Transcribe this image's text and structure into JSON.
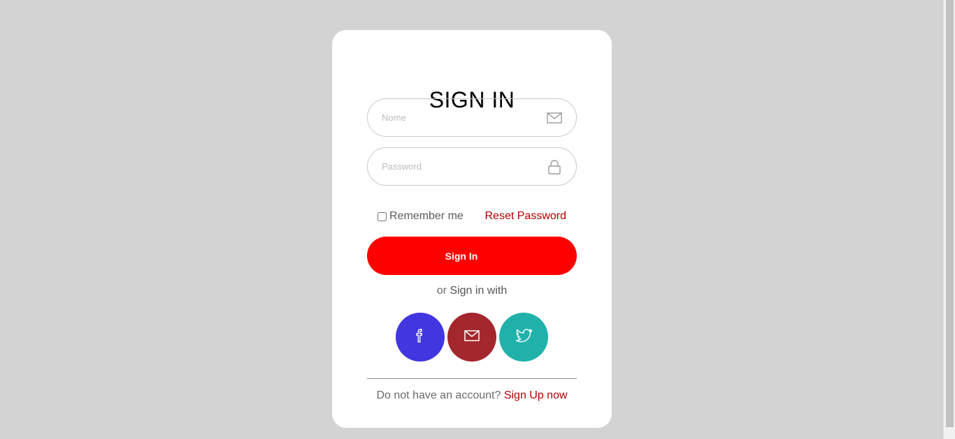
{
  "form": {
    "title": "SIGN IN",
    "name_placeholder": "Nome",
    "password_placeholder": "Password",
    "remember_label": "Remember me",
    "reset_label": "Reset Password",
    "submit_label": "Sign In",
    "or_prefix": "or",
    "or_text": "Sign in with"
  },
  "social": [
    {
      "name": "facebook",
      "icon": "facebook-icon",
      "color": "#4136e0"
    },
    {
      "name": "email",
      "icon": "mail-icon",
      "color": "#a3272c"
    },
    {
      "name": "twitter",
      "icon": "twitter-icon",
      "color": "#20b2aa"
    }
  ],
  "footer": {
    "prompt": "Do not have an account?",
    "signup_label": "Sign Up now"
  },
  "colors": {
    "background": "#d3d3d3",
    "accent": "#ff0000",
    "link": "#b30000"
  }
}
